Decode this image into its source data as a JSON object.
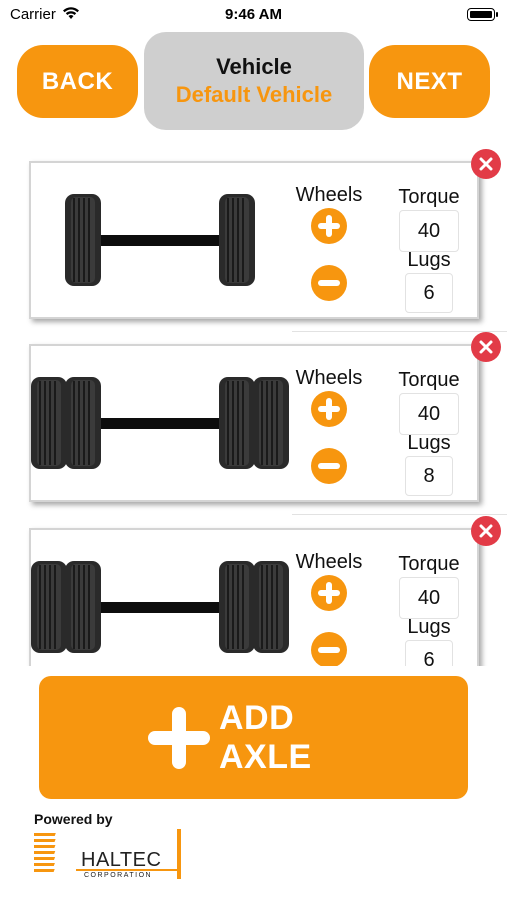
{
  "status_bar": {
    "carrier": "Carrier",
    "time": "9:46 AM"
  },
  "header": {
    "back_label": "BACK",
    "next_label": "NEXT",
    "vehicle_title": "Vehicle",
    "vehicle_name": "Default Vehicle"
  },
  "axles": [
    {
      "wheels_label": "Wheels",
      "torque_label": "Torque",
      "torque": "40",
      "lugs_label": "Lugs",
      "lugs": "6",
      "wheels_per_side": 1
    },
    {
      "wheels_label": "Wheels",
      "torque_label": "Torque",
      "torque": "40",
      "lugs_label": "Lugs",
      "lugs": "8",
      "wheels_per_side": 2
    },
    {
      "wheels_label": "Wheels",
      "torque_label": "Torque",
      "torque": "40",
      "lugs_label": "Lugs",
      "lugs": "6",
      "wheels_per_side": 2
    }
  ],
  "add_axle_label": "ADD AXLE",
  "footer": {
    "powered_by": "Powered by",
    "brand": "HALTEC",
    "brand_sub": "CORPORATION"
  },
  "colors": {
    "accent": "#f7960f",
    "danger": "#e23b47",
    "panel": "#cfcfcf"
  }
}
